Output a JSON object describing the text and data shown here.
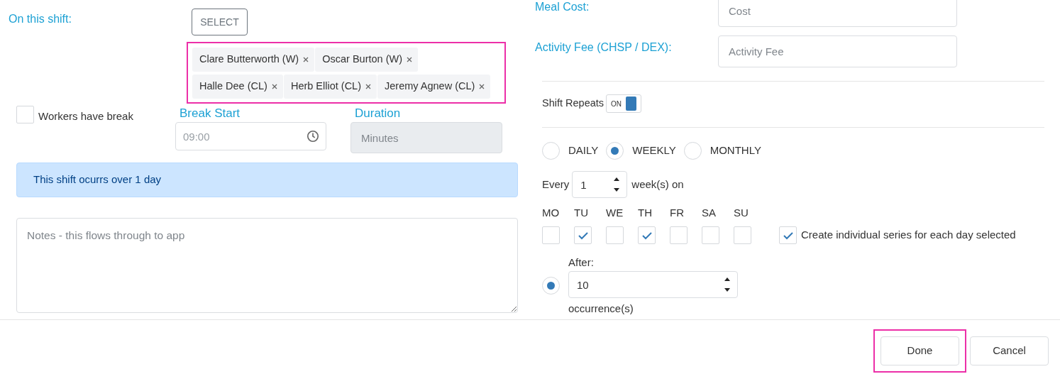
{
  "left": {
    "on_this_shift": {
      "label": "On this shift:",
      "select_button": "SELECT",
      "highlighted": true,
      "tags": [
        {
          "label": "Clare Butterworth (W)"
        },
        {
          "label": "Oscar Burton (W)"
        },
        {
          "label": "Halle Dee (CL)"
        },
        {
          "label": "Herb Elliot (CL)"
        },
        {
          "label": "Jeremy Agnew (CL)"
        }
      ]
    },
    "break": {
      "checkbox": {
        "label": "Workers have break",
        "checked": false
      },
      "break_start": {
        "label": "Break Start",
        "placeholder": "09:00"
      },
      "duration": {
        "label": "Duration",
        "placeholder": "Minutes",
        "disabled": true
      }
    },
    "alert": "This shift ocurrs over 1 day",
    "notes": {
      "placeholder": "Notes - this flows through to app"
    }
  },
  "right": {
    "meal_cost": {
      "label": "Meal Cost:",
      "placeholder": "Cost"
    },
    "activity_fee": {
      "label": "Activity Fee (CHSP / DEX):",
      "placeholder": "Activity Fee"
    },
    "shift_repeats": {
      "label": "Shift Repeats",
      "on": true,
      "toggle_text": "ON"
    },
    "frequency": [
      {
        "label": "DAILY",
        "selected": false
      },
      {
        "label": "WEEKLY",
        "selected": true
      },
      {
        "label": "MONTHLY",
        "selected": false
      }
    ],
    "every": {
      "label": "Every",
      "value": "1",
      "unit": "week(s) on"
    },
    "days": [
      {
        "label": "MO",
        "checked": false
      },
      {
        "label": "TU",
        "checked": true
      },
      {
        "label": "WE",
        "checked": false
      },
      {
        "label": "TH",
        "checked": true
      },
      {
        "label": "FR",
        "checked": false
      },
      {
        "label": "SA",
        "checked": false
      },
      {
        "label": "SU",
        "checked": false
      }
    ],
    "individual_series": {
      "label": "Create individual series for each day selected",
      "checked": true
    },
    "end": {
      "selected": true,
      "label": "After:",
      "value": "10",
      "unit": "occurrence(s)"
    }
  },
  "footer": {
    "buttons": [
      {
        "label": "Done",
        "highlighted": true
      },
      {
        "label": "Cancel",
        "highlighted": false
      }
    ]
  }
}
